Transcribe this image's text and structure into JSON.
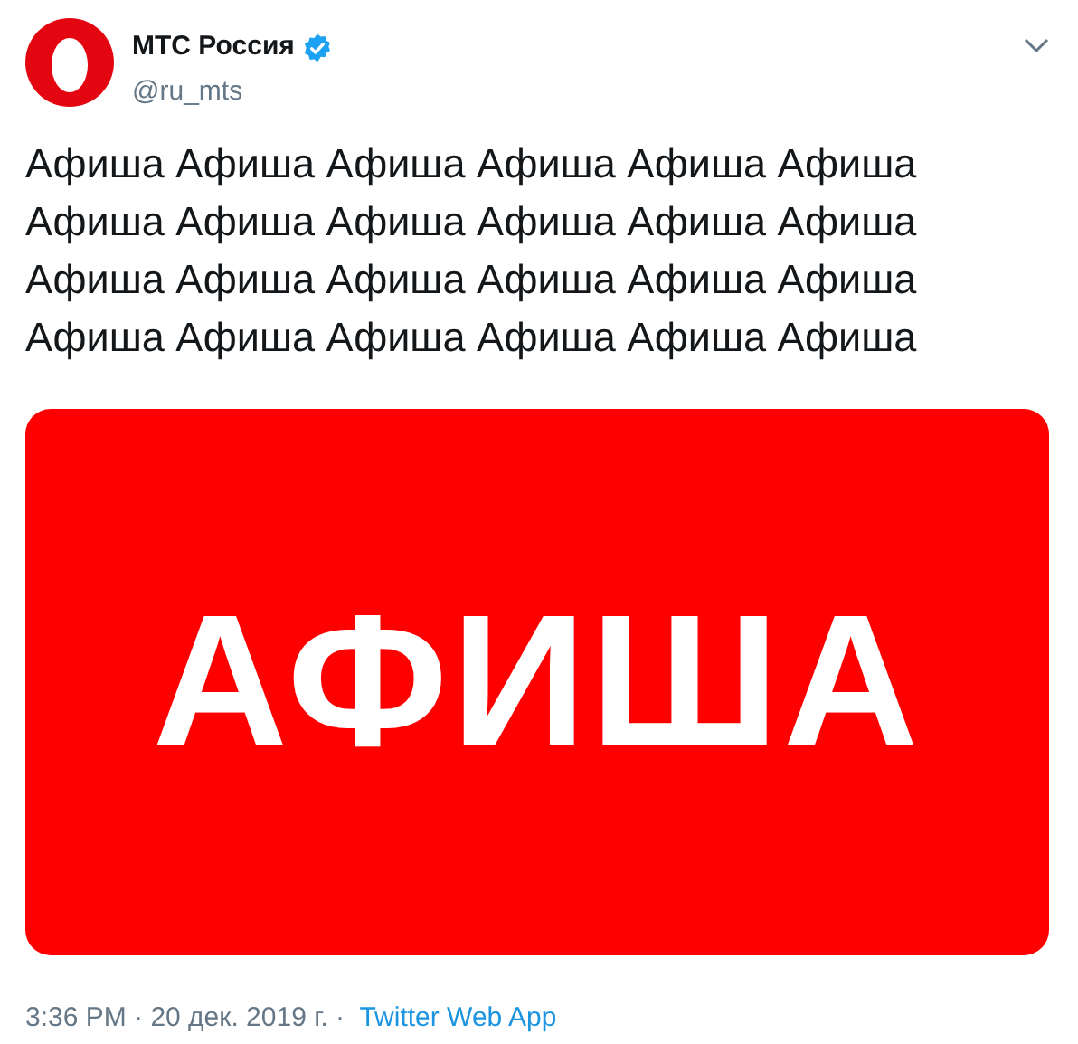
{
  "author": {
    "name": "МТС Россия",
    "verified": true,
    "handle": "@ru_mts"
  },
  "tweet": {
    "text": "Афиша Афиша Афиша Афиша Афиша Афиша Афиша Афиша Афиша Афиша Афиша Афиша Афиша Афиша Афиша Афиша Афиша Афиша Афиша Афиша Афиша Афиша Афиша Афиша"
  },
  "media": {
    "text": "АФИША"
  },
  "meta": {
    "time": "3:36 PM · 20 дек. 2019 г. · ",
    "source": "Twitter Web App"
  }
}
